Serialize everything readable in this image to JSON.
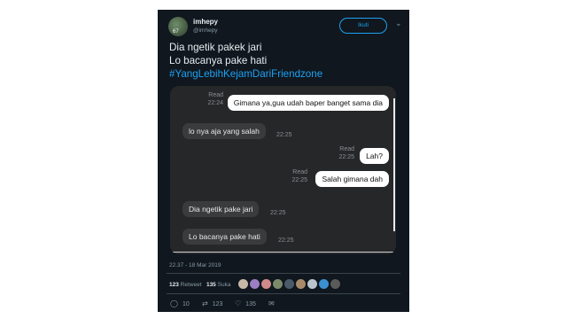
{
  "user": {
    "name": "imhepy",
    "handle": "@imhepy",
    "avatar_tag": "67"
  },
  "follow_label": "Ikuti",
  "tweet": {
    "line1": "Dia ngetik pakek jari",
    "line2": "Lo bacanya pake hati",
    "hashtag": "#YangLebihKejamDariFriendzone"
  },
  "chat": {
    "messages": [
      {
        "side": "right",
        "text": "Gimana ya,gua udah baper banget sama dia",
        "status": "Read",
        "time": "22:24"
      },
      {
        "side": "left",
        "text": "lo nya aja yang salah",
        "time": "22:25"
      },
      {
        "side": "right",
        "text": "Lah?",
        "status": "Read",
        "time": "22:25"
      },
      {
        "side": "right",
        "text": "Salah gimana dah",
        "status": "Read",
        "time": "22:25"
      },
      {
        "side": "left",
        "text": "Dia ngetik pake jari",
        "time": "22:25"
      },
      {
        "side": "left",
        "text": "Lo bacanya pake hati",
        "time": "22:25"
      }
    ]
  },
  "timestamp": "22.37 - 18 Mar 2019",
  "stats": {
    "retweets_count": "123",
    "retweets_label": "Retweet",
    "likes_count": "135",
    "likes_label": "Suka"
  },
  "actions": {
    "reply_count": "10",
    "retweet_count": "123",
    "like_count": "135"
  },
  "colors": {
    "background": "#10171e",
    "accent": "#1da1f2",
    "chat_bg": "#262729"
  }
}
